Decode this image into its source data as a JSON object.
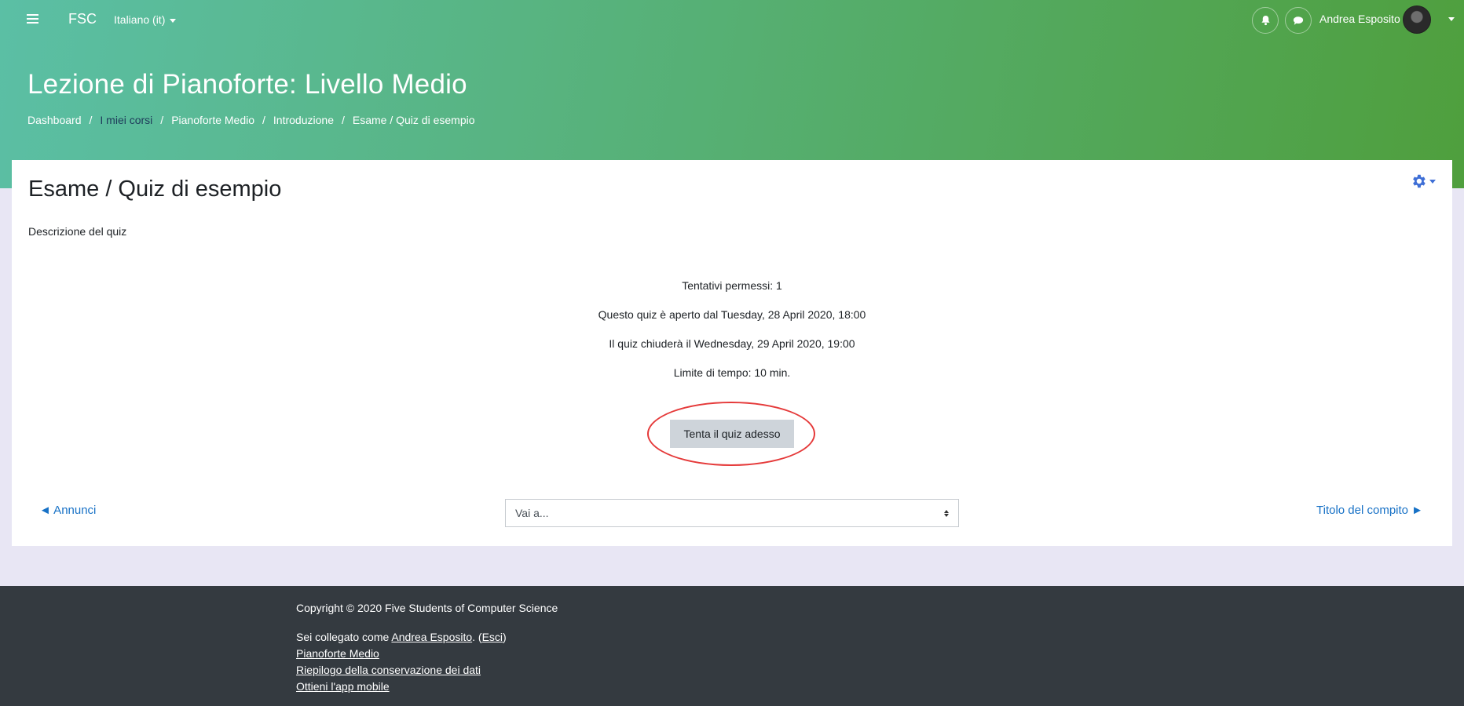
{
  "topbar": {
    "brand": "FSC",
    "language": "Italiano (it)",
    "username": "Andrea Esposito"
  },
  "header": {
    "course_title": "Lezione di Pianoforte: Livello Medio",
    "breadcrumb": [
      "Dashboard",
      "I miei corsi",
      "Pianoforte Medio",
      "Introduzione",
      "Esame / Quiz di esempio"
    ]
  },
  "main": {
    "title": "Esame / Quiz di esempio",
    "description": "Descrizione del quiz",
    "info": [
      "Tentativi permessi: 1",
      "Questo quiz è aperto dal Tuesday, 28 April 2020, 18:00",
      "Il quiz chiuderà il Wednesday, 29 April 2020, 19:00",
      "Limite di tempo: 10 min."
    ],
    "attempt_button": "Tenta il quiz adesso",
    "prev_link": "◄ Annunci",
    "next_link": "Titolo del compito ►",
    "jump_select": "Vai a..."
  },
  "footer": {
    "copyright": "Copyright © 2020 Five Students of Computer Science",
    "logged_in_prefix": "Sei collegato come ",
    "logged_in_user": "Andrea Esposito",
    "logout": "Esci",
    "links": [
      "Pianoforte Medio",
      "Riepilogo della conservazione dei dati",
      "Ottieni l'app mobile"
    ]
  },
  "colors": {
    "accent": "#1771c6",
    "highlight": "#e53a3a",
    "footer_bg": "#343a40"
  },
  "icons": [
    "hamburger-icon",
    "bell-icon",
    "chat-icon",
    "gear-icon",
    "caret-down-icon"
  ]
}
